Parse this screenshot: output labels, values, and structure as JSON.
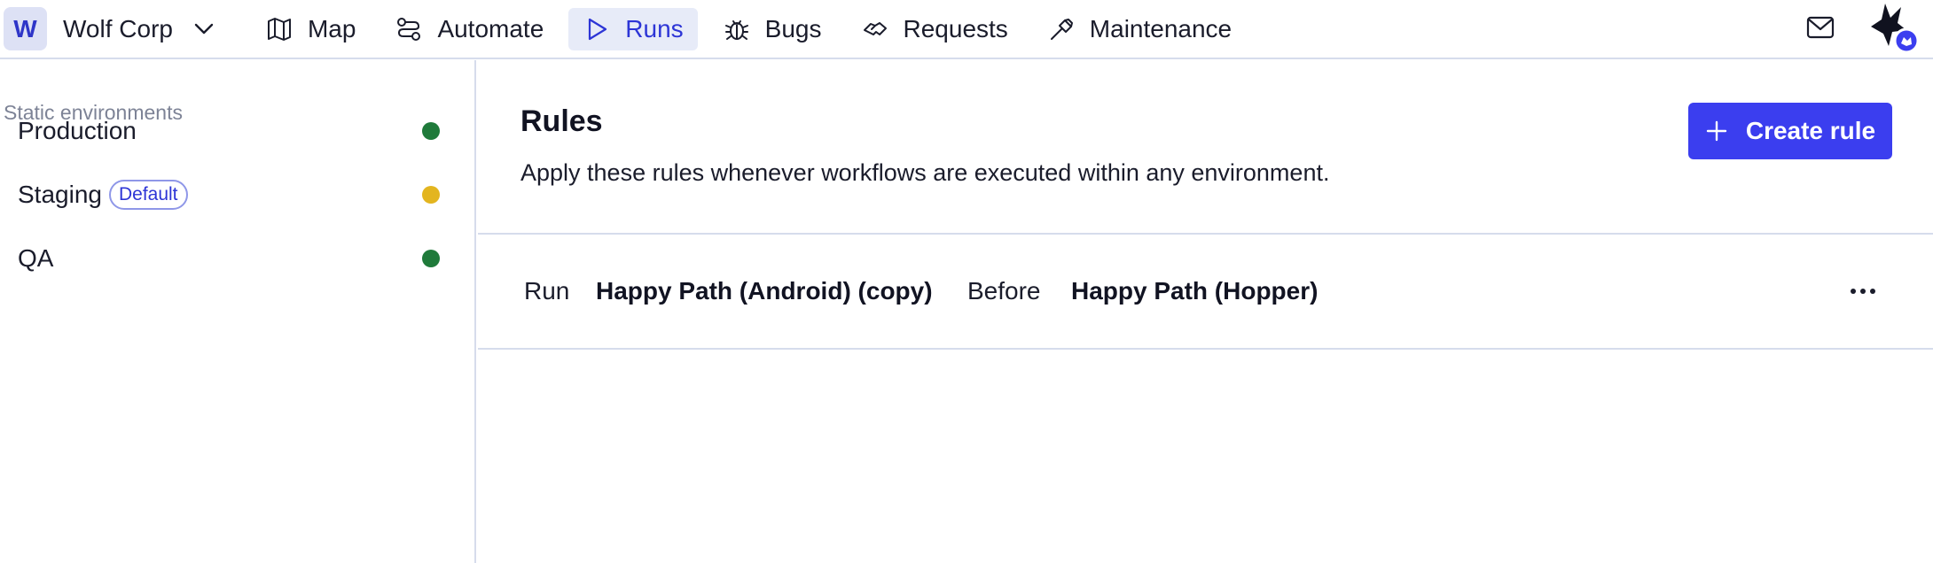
{
  "org": {
    "initial": "W",
    "name": "Wolf Corp"
  },
  "nav": [
    {
      "label": "Map",
      "icon": "map-icon",
      "active": false
    },
    {
      "label": "Automate",
      "icon": "workflow-icon",
      "active": false
    },
    {
      "label": "Runs",
      "icon": "play-icon",
      "active": true
    },
    {
      "label": "Bugs",
      "icon": "bug-icon",
      "active": false
    },
    {
      "label": "Requests",
      "icon": "handshake-icon",
      "active": false
    },
    {
      "label": "Maintenance",
      "icon": "hammer-icon",
      "active": false
    }
  ],
  "sidebar": {
    "heading": "Static environments",
    "environments": [
      {
        "label": "Production",
        "badge": "",
        "status_color": "#1f7a3a"
      },
      {
        "label": "Staging",
        "badge": "Default",
        "status_color": "#e3b51f"
      },
      {
        "label": "QA",
        "badge": "",
        "status_color": "#1f7a3a"
      }
    ]
  },
  "main": {
    "title": "Rules",
    "description": "Apply these rules whenever workflows are executed within any environment.",
    "create_button_label": "Create rule",
    "rules": [
      {
        "run_word": "Run",
        "workflow": "Happy Path (Android) (copy)",
        "relation": "Before",
        "target": "Happy Path (Hopper)"
      }
    ]
  },
  "colors": {
    "accent": "#3b3eef",
    "active_nav_bg": "#e7ebf8",
    "active_nav_text": "#2d35d6",
    "border": "#d6dcec"
  }
}
